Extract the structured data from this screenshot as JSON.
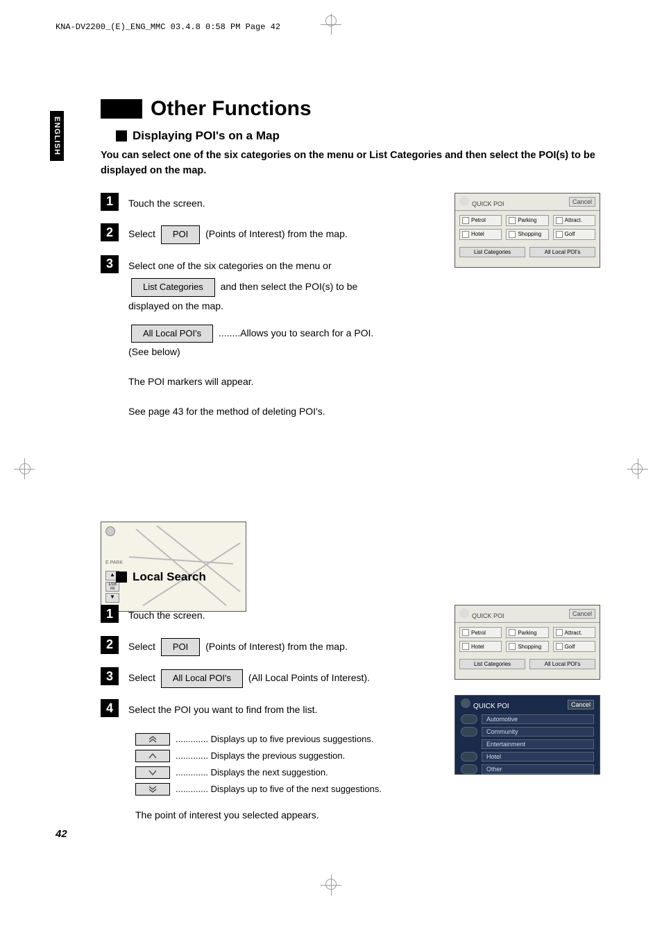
{
  "header_line": "KNA-DV2200_(E)_ENG_MMC  03.4.8  0:58 PM  Page 42",
  "lang_tab": "ENGLISH",
  "main_title": "Other Functions",
  "section1": {
    "subtitle": "Displaying POI's on a Map",
    "intro": "You can select one of the six categories on the menu or List Categories and then select the POI(s) to be displayed on the map.",
    "steps": {
      "s1": "Touch the screen.",
      "s2_a": "Select",
      "s2_btn": "POI",
      "s2_b": "(Points of Interest) from the map.",
      "s3_a": "Select one of the six categories on the menu or",
      "s3_btn1": "List Categories",
      "s3_b": "and then select the POI(s) to be displayed on the map.",
      "s3_btn2": "All Local POI's",
      "s3_c": "........Allows you to search for a POI. (See below)",
      "s3_d": "The POI markers will appear.",
      "s3_e": "See page 43 for the method of deleting POI's."
    },
    "screenshot1": {
      "title": "QUICK POI",
      "cancel": "Cancel",
      "buttons": [
        "Petrol",
        "Parking",
        "Attract.",
        "Hotel",
        "Shopping",
        "Golf"
      ],
      "footer": [
        "List Categories",
        "All Local POI's"
      ]
    },
    "screenshot2": {
      "label": "E PARK"
    }
  },
  "section2": {
    "subtitle": "Local Search",
    "steps": {
      "s1": "Touch the screen.",
      "s2_a": "Select",
      "s2_btn": "POI",
      "s2_b": "(Points of Interest) from the map.",
      "s3_a": "Select",
      "s3_btn": "All Local POI's",
      "s3_b": "(All Local Points of Interest).",
      "s4": "Select the POI you want to find from the list."
    },
    "screenshot1": {
      "title": "QUICK POI",
      "cancel": "Cancel",
      "buttons": [
        "Petrol",
        "Parking",
        "Attract.",
        "Hotel",
        "Shopping",
        "Golf"
      ],
      "footer": [
        "List Categories",
        "All Local POI's"
      ]
    },
    "screenshot2": {
      "title": "QUICK POI",
      "cancel": "Cancel",
      "items": [
        "Automotive",
        "Community",
        "Entertainment",
        "Hotel",
        "Other"
      ]
    },
    "arrows": {
      "a1": "............. Displays up to five previous suggestions.",
      "a2": "............. Displays the previous suggestion.",
      "a3": "............. Displays the next suggestion.",
      "a4": "............. Displays up to five of the next suggestions."
    },
    "final": "The point of interest you selected appears."
  },
  "page_num": "42"
}
